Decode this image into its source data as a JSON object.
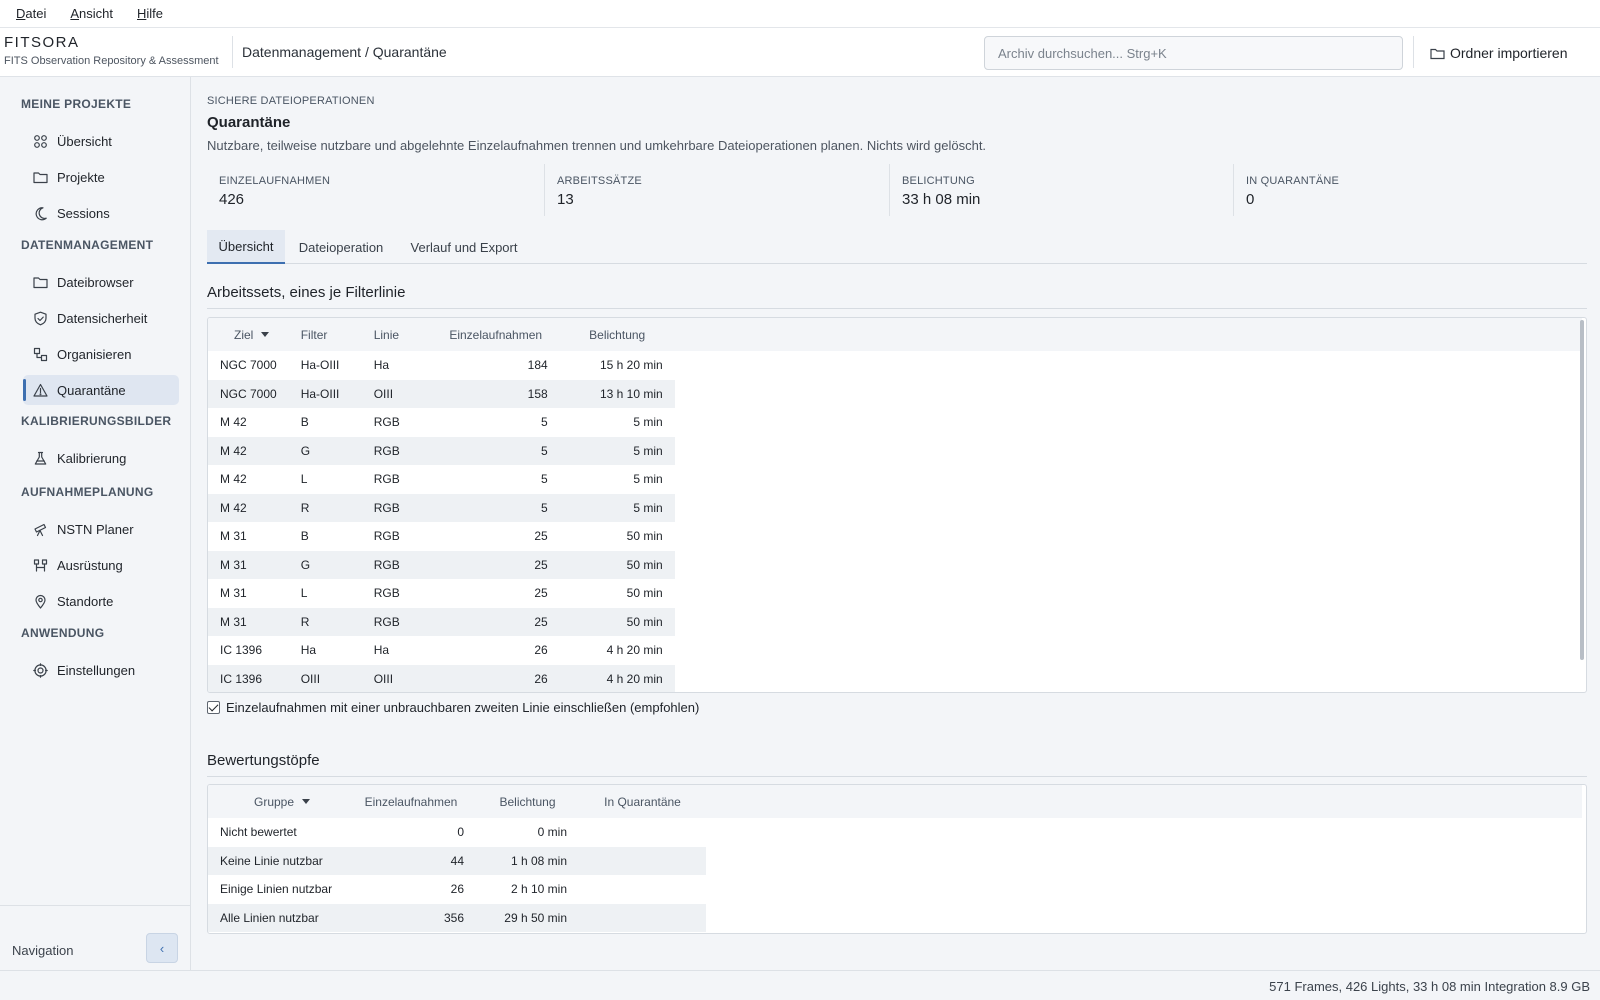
{
  "menubar": {
    "items": [
      {
        "first": "D",
        "rest": "atei"
      },
      {
        "first": "A",
        "rest": "nsicht"
      },
      {
        "first": "H",
        "rest": "ilfe"
      }
    ]
  },
  "header": {
    "brand_name": "FITSORA",
    "brand_subtitle": "FITS Observation Repository & Assessment",
    "breadcrumb": "Datenmanagement / Quarantäne",
    "search_placeholder": "Archiv durchsuchen...  Strg+K",
    "import_label": "Ordner importieren"
  },
  "sidebar": {
    "sections": [
      {
        "label": "MEINE PROJEKTE",
        "items": [
          {
            "label": "Übersicht",
            "icon": "grid-icon"
          },
          {
            "label": "Projekte",
            "icon": "folder-icon"
          },
          {
            "label": "Sessions",
            "icon": "moon-icon"
          }
        ]
      },
      {
        "label": "DATENMANAGEMENT",
        "items": [
          {
            "label": "Dateibrowser",
            "icon": "folder-icon"
          },
          {
            "label": "Datensicherheit",
            "icon": "shield-icon"
          },
          {
            "label": "Organisieren",
            "icon": "organize-icon"
          },
          {
            "label": "Quarantäne",
            "icon": "warning-icon",
            "active": true
          }
        ]
      },
      {
        "label": "KALIBRIERUNGSBILDER",
        "items": [
          {
            "label": "Kalibrierung",
            "icon": "flask-icon"
          }
        ]
      },
      {
        "label": "AUFNAHMEPLANUNG",
        "items": [
          {
            "label": "NSTN Planer",
            "icon": "telescope-icon"
          },
          {
            "label": "Ausrüstung",
            "icon": "equipment-icon"
          },
          {
            "label": "Standorte",
            "icon": "location-icon"
          }
        ]
      },
      {
        "label": "ANWENDUNG",
        "items": [
          {
            "label": "Einstellungen",
            "icon": "settings-icon"
          }
        ]
      }
    ],
    "footer_label": "Navigation",
    "collapse_glyph": "‹"
  },
  "page": {
    "eyebrow": "SICHERE DATEIOPERATIONEN",
    "title": "Quarantäne",
    "description": "Nutzbare, teilweise nutzbare und abgelehnte Einzelaufnahmen trennen und umkehrbare Dateioperationen planen. Nichts wird gelöscht.",
    "stats": [
      {
        "label": "EINZELAUFNAHMEN",
        "value": "426"
      },
      {
        "label": "ARBEITSSÄTZE",
        "value": "13"
      },
      {
        "label": "BELICHTUNG",
        "value": "33 h 08 min"
      },
      {
        "label": "IN QUARANTÄNE",
        "value": "0"
      }
    ],
    "tabs": [
      "Übersicht",
      "Dateioperation",
      "Verlauf und Export"
    ],
    "active_tab": 0
  },
  "worksets": {
    "heading": "Arbeitssets, eines je Filterlinie",
    "columns": [
      "Ziel",
      "Filter",
      "Linie",
      "Einzelaufnahmen",
      "Belichtung"
    ],
    "rows": [
      [
        "NGC 7000",
        "Ha-OIII",
        "Ha",
        "184",
        "15 h 20 min"
      ],
      [
        "NGC 7000",
        "Ha-OIII",
        "OIII",
        "158",
        "13 h 10 min"
      ],
      [
        "M 42",
        "B",
        "RGB",
        "5",
        "5 min"
      ],
      [
        "M 42",
        "G",
        "RGB",
        "5",
        "5 min"
      ],
      [
        "M 42",
        "L",
        "RGB",
        "5",
        "5 min"
      ],
      [
        "M 42",
        "R",
        "RGB",
        "5",
        "5 min"
      ],
      [
        "M 31",
        "B",
        "RGB",
        "25",
        "50 min"
      ],
      [
        "M 31",
        "G",
        "RGB",
        "25",
        "50 min"
      ],
      [
        "M 31",
        "L",
        "RGB",
        "25",
        "50 min"
      ],
      [
        "M 31",
        "R",
        "RGB",
        "25",
        "50 min"
      ],
      [
        "IC 1396",
        "Ha",
        "Ha",
        "26",
        "4 h 20 min"
      ],
      [
        "IC 1396",
        "OIII",
        "OIII",
        "26",
        "4 h 20 min"
      ]
    ],
    "checkbox_label": "Einzelaufnahmen mit einer unbrauchbaren zweiten Linie einschließen (empfohlen)",
    "checkbox_checked": true
  },
  "buckets": {
    "heading": "Bewertungstöpfe",
    "columns": [
      "Gruppe",
      "Einzelaufnahmen",
      "Belichtung",
      "In Quarantäne"
    ],
    "rows": [
      [
        "Nicht bewertet",
        "0",
        "0 min",
        ""
      ],
      [
        "Keine Linie nutzbar",
        "44",
        "1 h 08 min",
        ""
      ],
      [
        "Einige Linien nutzbar",
        "26",
        "2 h 10 min",
        ""
      ],
      [
        "Alle Linien nutzbar",
        "356",
        "29 h 50 min",
        ""
      ]
    ]
  },
  "statusbar": {
    "text": "571 Frames, 426 Lights, 33 h 08 min Integration  8.9 GB"
  }
}
